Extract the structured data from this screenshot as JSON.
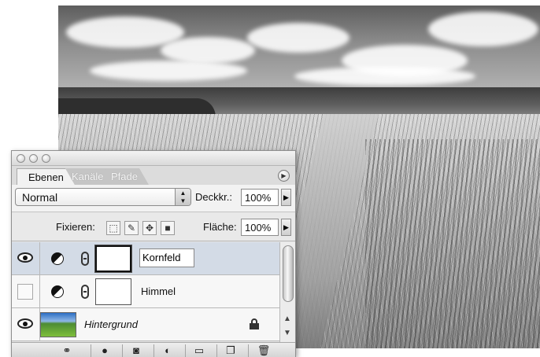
{
  "palette": {
    "tabs": [
      {
        "label": "Ebenen"
      },
      {
        "label": "Kanäle"
      },
      {
        "label": "Pfade"
      }
    ],
    "blend_mode": "Normal",
    "opacity_label": "Deckkr.:",
    "opacity_value": "100%",
    "lock_label": "Fixieren:",
    "fill_label": "Fläche:",
    "fill_value": "100%",
    "layers": [
      {
        "name": "Kornfeld",
        "visible": true,
        "selected": true
      },
      {
        "name": "Himmel",
        "visible": false,
        "selected": false
      },
      {
        "name": "Hintergrund",
        "visible": true,
        "selected": false,
        "locked": true
      }
    ]
  },
  "icons": {
    "eye": "eye-icon",
    "adjustment": "adjustment-layer-icon",
    "link": "link-chain-icon",
    "lock": "lock-icon",
    "menu": "palette-menu-icon"
  },
  "colors": {
    "palette_bg": "#e6e6e6",
    "selected_row": "#d3dbe6"
  }
}
